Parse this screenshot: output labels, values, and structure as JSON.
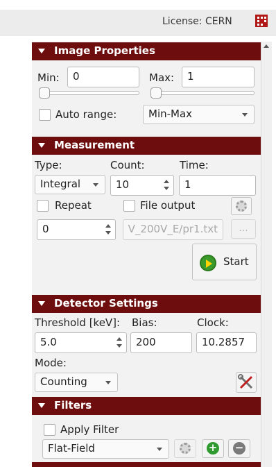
{
  "header": {
    "license_text": "License: CERN",
    "license_icon": "grid-icon"
  },
  "image_properties": {
    "title": "Image Properties",
    "min_label": "Min:",
    "min_value": "0",
    "max_label": "Max:",
    "max_value": "1",
    "min_slider_level": 0,
    "max_slider_level": 0,
    "auto_range_label": "Auto range:",
    "auto_range_checked": false,
    "range_mode": "Min-Max"
  },
  "measurement": {
    "title": "Measurement",
    "type_label": "Type:",
    "count_label": "Count:",
    "time_label": "Time:",
    "type_value": "Integral",
    "count_value": "10",
    "time_value": "1",
    "repeat_label": "Repeat",
    "repeat_checked": false,
    "file_output_label": "File output",
    "file_output_checked": false,
    "repeat_value": "0",
    "file_path": "V_200V_E/pr1.txt",
    "browse_label": "...",
    "start_label": "Start"
  },
  "detector": {
    "title": "Detector Settings",
    "threshold_label": "Threshold [keV]:",
    "bias_label": "Bias:",
    "clock_label": "Clock:",
    "threshold_value": "5.0",
    "bias_value": "200",
    "clock_value": "10.2857",
    "mode_label": "Mode:",
    "mode_value": "Counting"
  },
  "filters": {
    "title": "Filters",
    "apply_label": "Apply Filter",
    "apply_checked": false,
    "filter_value": "Flat-Field"
  },
  "colors": {
    "section_header": "#6d0d0d",
    "start_icon": "#3a9a2a",
    "add_button": "#2f9a2f",
    "remove_button": "#7a7a7a"
  }
}
